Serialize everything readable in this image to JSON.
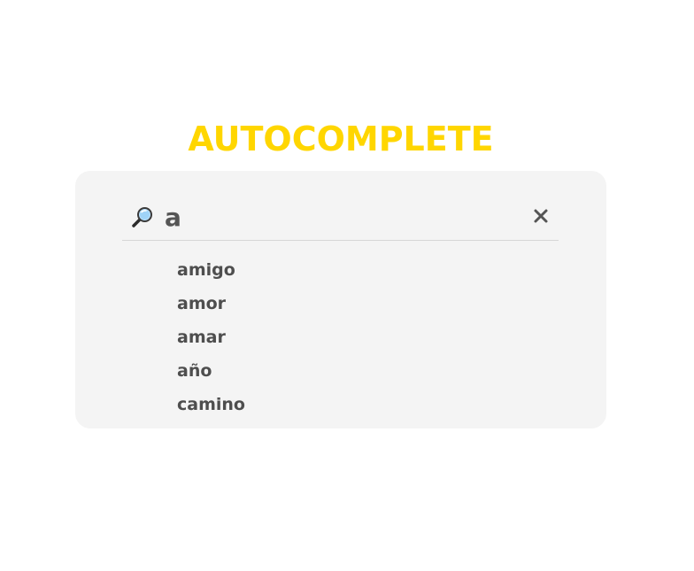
{
  "title": "AUTOCOMPLETE",
  "search": {
    "value": "a",
    "icon": "magnifying-glass-icon",
    "clear_icon": "close-icon"
  },
  "suggestions": [
    "amigo",
    "amor",
    "amar",
    "año",
    "camino"
  ],
  "colors": {
    "title": "#FFD600",
    "panel_background": "#f4f4f4",
    "text": "#4e4e4e",
    "divider": "#d6d6d6"
  }
}
